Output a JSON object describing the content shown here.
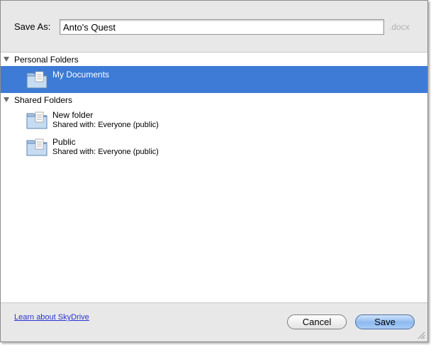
{
  "header": {
    "save_as_label": "Save As:",
    "filename_value": "Anto's Quest",
    "extension": ".docx"
  },
  "sections": {
    "personal": {
      "label": "Personal Folders"
    },
    "shared": {
      "label": "Shared Folders"
    }
  },
  "folders": {
    "my_documents": {
      "name": "My Documents",
      "selected": true,
      "icon": "folder-icon"
    },
    "new_folder": {
      "name": "New folder",
      "shared_with": "Shared with: Everyone (public)",
      "icon": "folder-icon"
    },
    "public": {
      "name": "Public",
      "shared_with": "Shared with: Everyone (public)",
      "icon": "folder-icon"
    }
  },
  "footer": {
    "learn_link": "Learn about SkyDrive",
    "cancel_label": "Cancel",
    "save_label": "Save"
  },
  "colors": {
    "selection": "#3d7bd6",
    "link": "#2a31d6",
    "default_button": "#8db9ef"
  }
}
